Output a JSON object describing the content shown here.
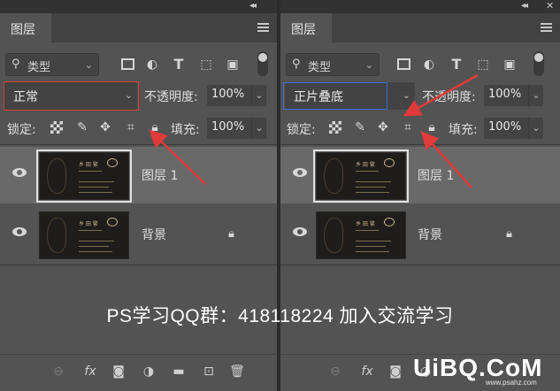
{
  "left_panel": {
    "tab_title": "图层",
    "filter": {
      "label": "类型"
    },
    "blend_mode": "正常",
    "opacity_label": "不透明度:",
    "opacity_value": "100%",
    "lock_label": "锁定:",
    "fill_label": "填充:",
    "fill_value": "100%",
    "layers": [
      {
        "name": "图层 1",
        "selected": true
      },
      {
        "name": "背景",
        "locked": true
      }
    ]
  },
  "right_panel": {
    "tab_title": "图层",
    "filter": {
      "label": "类型"
    },
    "blend_mode": "正片叠底",
    "opacity_label": "不透明度:",
    "opacity_value": "100%",
    "lock_label": "锁定:",
    "fill_label": "填充:",
    "fill_value": "100%",
    "layers": [
      {
        "name": "图层 1",
        "selected": true
      },
      {
        "name": "背景",
        "locked": true
      }
    ]
  },
  "overlay_text": "PS学习QQ群：418118224  加入交流学习",
  "watermark": {
    "main": "UiBQ.CoM",
    "sub": "www.psahz.com"
  },
  "thumbnail": {
    "card_name": "乡 田 繁"
  },
  "colors": {
    "panel": "#535353",
    "selected_row": "#696969",
    "highlight_red": "#d83c3c",
    "highlight_blue": "#3a6fd0"
  },
  "icons": {
    "filter_row": [
      "image-filter-icon",
      "adjustment-filter-icon",
      "type-filter-icon",
      "shape-filter-icon",
      "smart-object-filter-icon"
    ],
    "lock_row": [
      "lock-transparent-pixels-icon",
      "lock-image-pixels-icon",
      "lock-position-icon",
      "lock-artboard-icon",
      "lock-all-icon"
    ],
    "bottom_bar": [
      "link-layers-icon",
      "fx-icon",
      "add-mask-icon",
      "adjustment-layer-icon",
      "new-group-icon",
      "new-layer-icon",
      "trash-icon"
    ]
  }
}
